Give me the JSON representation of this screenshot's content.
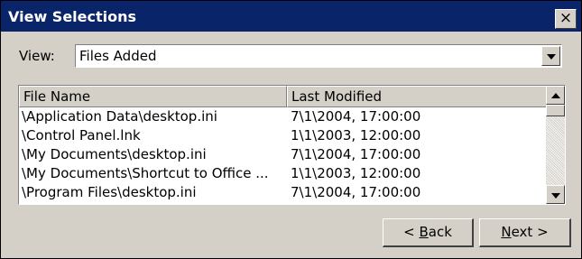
{
  "window": {
    "title": "View Selections",
    "close_label": "×"
  },
  "view": {
    "label": "View:",
    "selected": "Files Added"
  },
  "list": {
    "columns": [
      "File Name",
      "Last Modified"
    ],
    "rows": [
      {
        "file": "\\Application Data\\desktop.ini",
        "modified": "7\\1\\2004, 17:00:00"
      },
      {
        "file": "\\Control Panel.lnk",
        "modified": "1\\1\\2003, 12:00:00"
      },
      {
        "file": "\\My Documents\\desktop.ini",
        "modified": "7\\1\\2004, 17:00:00"
      },
      {
        "file": "\\My Documents\\Shortcut to Office ...",
        "modified": "1\\1\\2003, 12:00:00"
      },
      {
        "file": "\\Program Files\\desktop.ini",
        "modified": "7\\1\\2004, 17:00:00"
      }
    ]
  },
  "buttons": {
    "back": {
      "prefix": "< ",
      "mnemonic": "B",
      "rest": "ack"
    },
    "next": {
      "prefix": "",
      "mnemonic": "N",
      "rest": "ext >"
    }
  },
  "icons": [
    "close-icon",
    "dropdown-arrow-icon",
    "scroll-up-icon",
    "scroll-down-icon"
  ],
  "colors": {
    "titlebar": "#0a246a",
    "face": "#d4d0c8",
    "window": "#ffffff"
  }
}
